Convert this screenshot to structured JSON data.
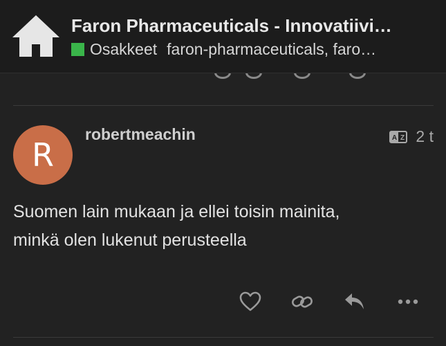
{
  "header": {
    "home_icon": "home-icon",
    "topic_title": "Faron Pharmaceuticals - Innovatiivi…",
    "category": {
      "name": "Osakkeet",
      "color": "#3ab54a"
    },
    "tags_text": "faron-pharmaceuticals, faro…"
  },
  "post": {
    "avatar_letter": "R",
    "avatar_color": "#c96e48",
    "username": "robertmeachin",
    "date": "2 t",
    "translate_icon": "translate-icon",
    "body_lines": [
      "Suomen lain mukaan ja ellei toisin mainita,",
      "minkä olen lukenut perusteella"
    ]
  },
  "actions": [
    {
      "name": "like-button",
      "icon": "heart-icon"
    },
    {
      "name": "copy-link-button",
      "icon": "link-icon"
    },
    {
      "name": "reply-button",
      "icon": "reply-icon"
    },
    {
      "name": "more-actions-button",
      "icon": "ellipsis-icon"
    }
  ]
}
